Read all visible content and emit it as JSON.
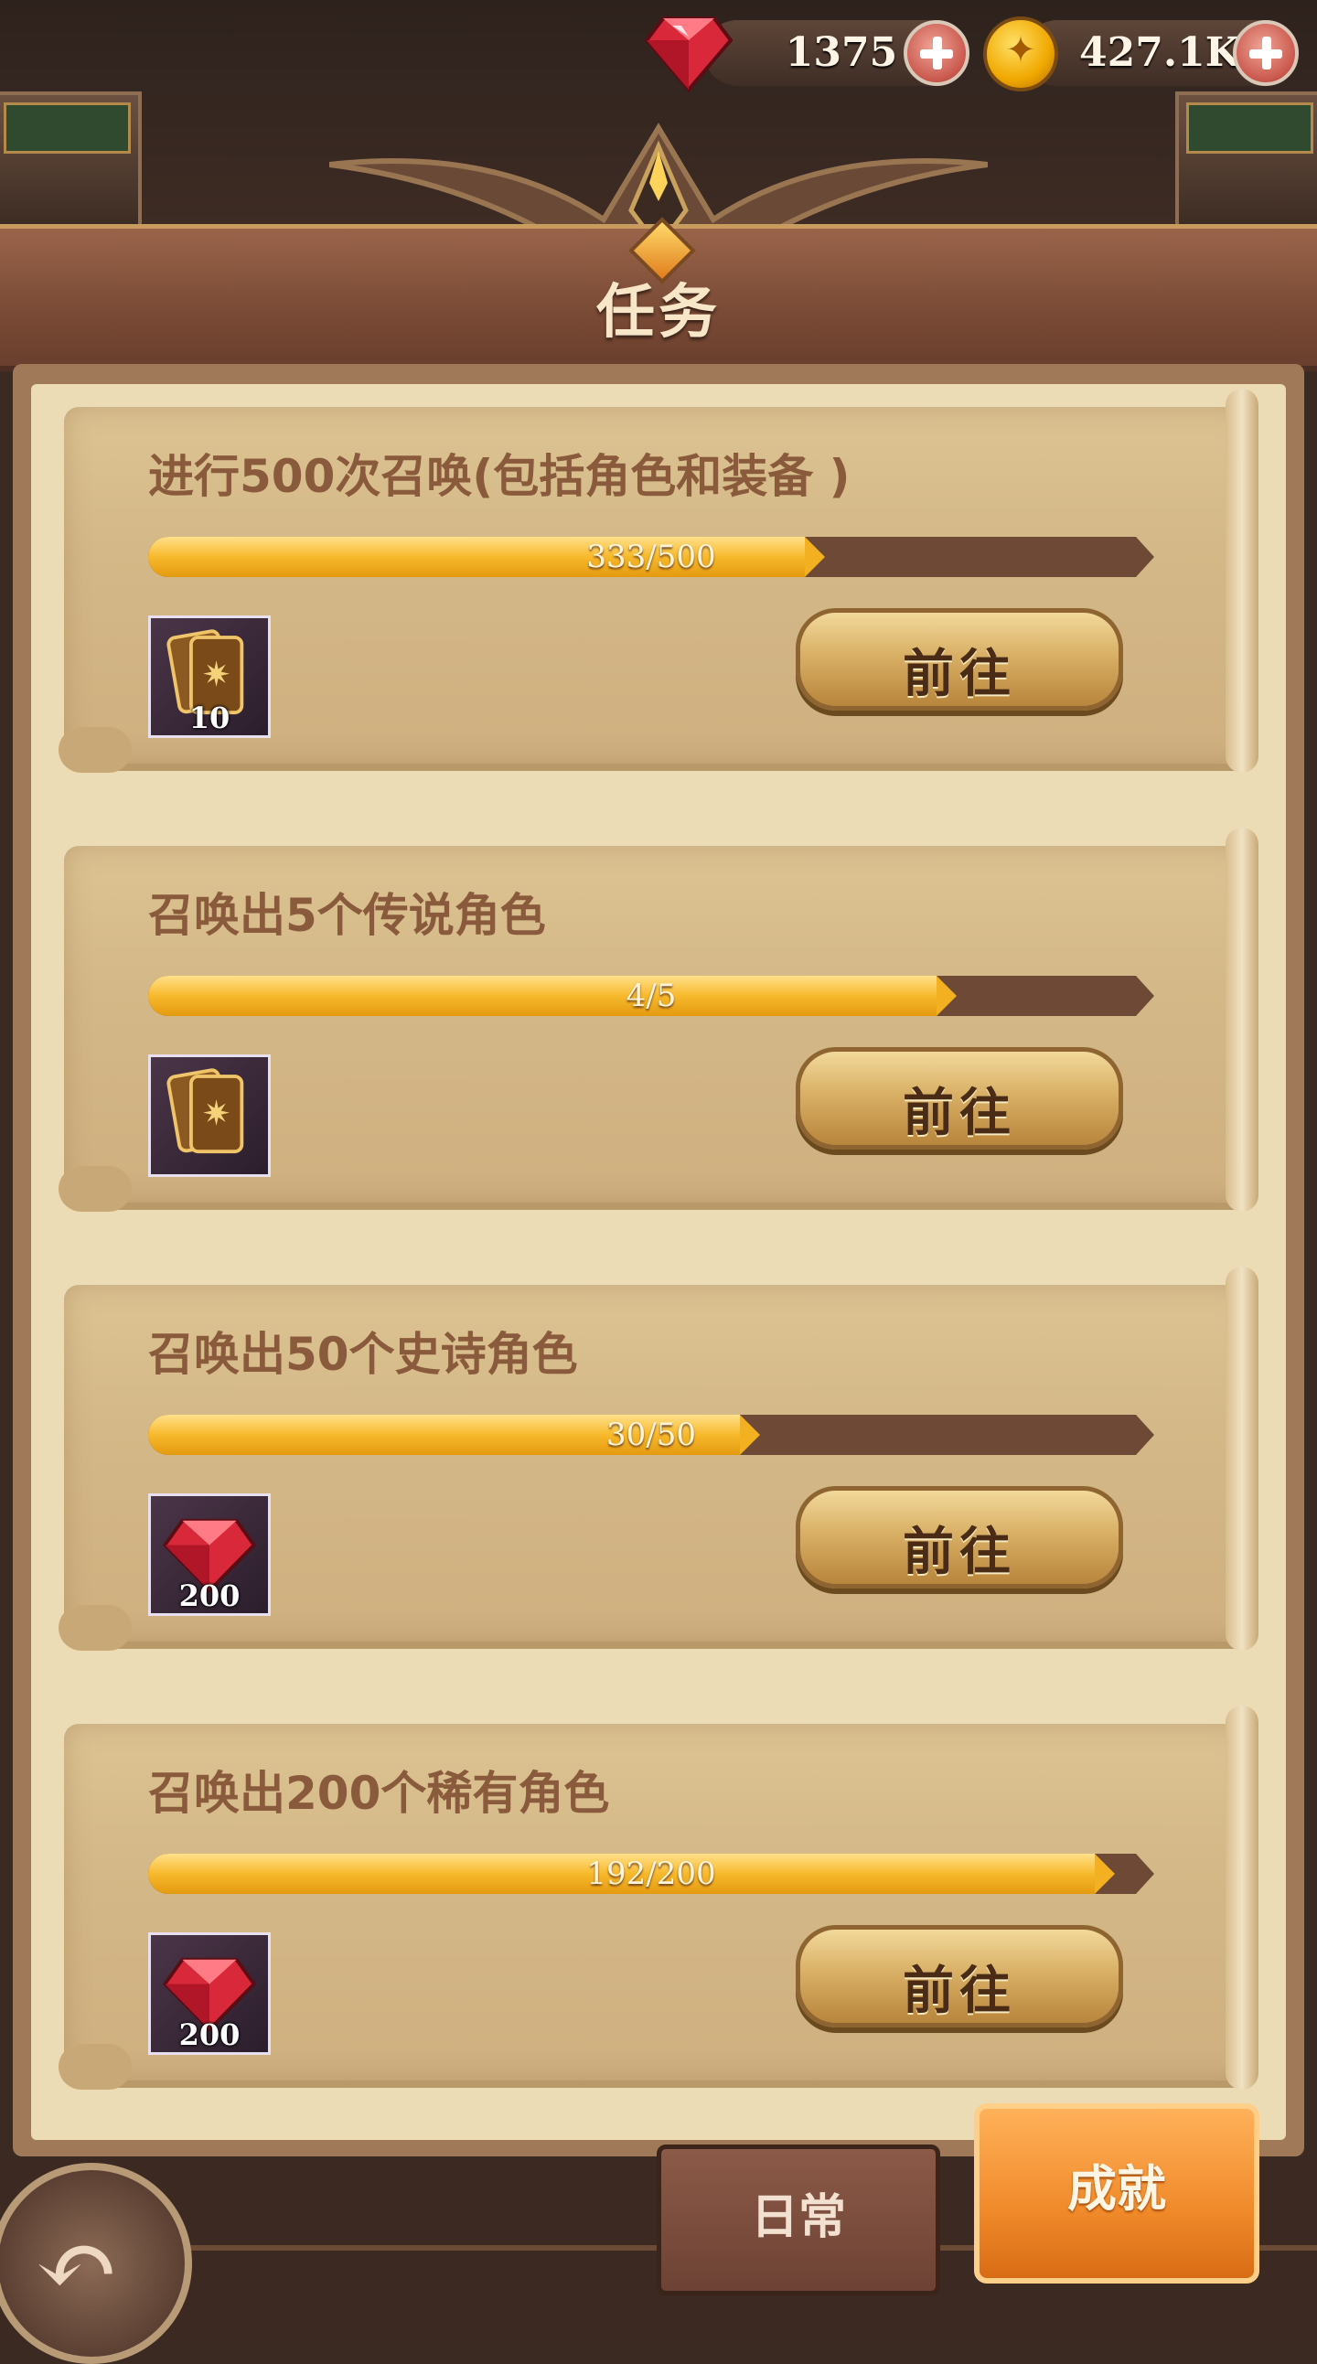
{
  "header": {
    "gems": {
      "value": "1375",
      "icon": "ruby-gem-icon"
    },
    "gold": {
      "value": "427.1K",
      "icon": "gold-coin-icon"
    },
    "title": "任务"
  },
  "quests": [
    {
      "title": "进行500次召唤(包括角色和装备 )",
      "progress_label": "333/500",
      "progress": 0.666,
      "reward_icon": "summon-cards-icon",
      "reward_qty": "10",
      "button": "前往"
    },
    {
      "title": "召唤出5个传说角色",
      "progress_label": "4/5",
      "progress": 0.8,
      "reward_icon": "summon-cards-icon",
      "reward_qty": "",
      "button": "前往"
    },
    {
      "title": "召唤出50个史诗角色",
      "progress_label": "30/50",
      "progress": 0.6,
      "reward_icon": "ruby-gem-icon",
      "reward_qty": "200",
      "button": "前往"
    },
    {
      "title": "召唤出200个稀有角色",
      "progress_label": "192/200",
      "progress": 0.96,
      "reward_icon": "ruby-gem-icon",
      "reward_qty": "200",
      "button": "前往"
    }
  ],
  "tabs": {
    "daily": "日常",
    "achievement": "成就",
    "active": "achievement"
  },
  "colors": {
    "accent": "#f08a2a",
    "progress_fill": "#f7b92c",
    "gem": "#d9283a"
  }
}
